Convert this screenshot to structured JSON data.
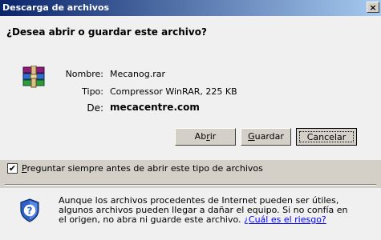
{
  "window": {
    "title": "Descarga de archivos",
    "close_label": "×"
  },
  "dialog": {
    "question": "¿Desea abrir o guardar este archivo?",
    "file": {
      "name_label": "Nombre:",
      "name": "Mecanog.rar",
      "type_label": "Tipo:",
      "type": "Compressor WinRAR, 225 KB",
      "from_label": "De:",
      "from": "mecacentre.com"
    },
    "buttons": {
      "open": {
        "pre": "Ab",
        "accel": "r",
        "post": "ir"
      },
      "save": {
        "pre": "",
        "accel": "G",
        "post": "uardar"
      },
      "cancel": "Cancelar"
    },
    "checkbox": {
      "checked": true,
      "mark": "✔",
      "accel": "P",
      "label_rest": "reguntar siempre antes de abrir este tipo de archivos"
    },
    "warning": {
      "line1": "Aunque los archivos procedentes de Internet pueden ser útiles,",
      "line2": "algunos archivos pueden llegar a dañar el equipo. Si no confía en",
      "line3_text": "el origen, no abra ni guarde este archivo. ",
      "link": "¿Cuál es el riesgo?"
    }
  },
  "icons": {
    "file": "winrar-archive-icon",
    "security": "security-shield-icon"
  }
}
